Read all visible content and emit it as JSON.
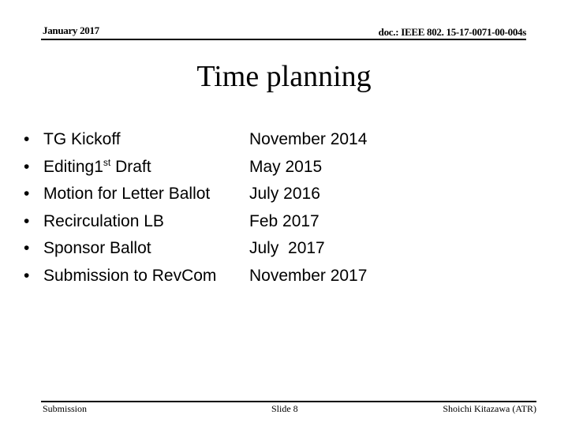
{
  "header": {
    "date": "January 2017",
    "doc_id": "doc.: IEEE 802. 15-17-0071-00-004s"
  },
  "slide": {
    "title": "Time planning",
    "bullet_glyph": "•",
    "items": [
      {
        "label": "TG Kickoff",
        "label_sup": "",
        "label_suffix": "",
        "date": "November 2014"
      },
      {
        "label": "Editing1",
        "label_sup": "st",
        "label_suffix": " Draft",
        "date": "May 2015"
      },
      {
        "label": "Motion for Letter Ballot",
        "label_sup": "",
        "label_suffix": "",
        "date": "July 2016"
      },
      {
        "label": "Recirculation LB",
        "label_sup": "",
        "label_suffix": "",
        "date": "Feb 2017"
      },
      {
        "label": "Sponsor Ballot",
        "label_sup": "",
        "label_suffix": "",
        "date": "July  2017"
      },
      {
        "label": "Submission to RevCom",
        "label_sup": "",
        "label_suffix": "",
        "date": "November 2017"
      }
    ]
  },
  "footer": {
    "left": "Submission",
    "center": "Slide 8",
    "right": "Shoichi Kitazawa (ATR)"
  }
}
